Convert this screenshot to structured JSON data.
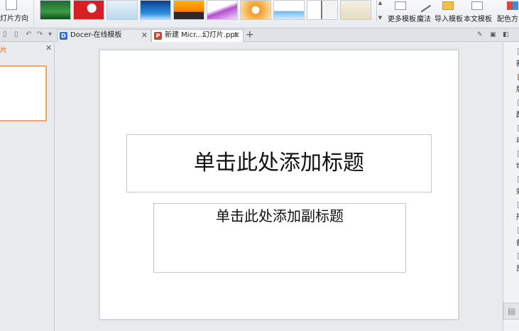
{
  "ribbon": {
    "direction_label": "灯片方向",
    "more_templates": "更多模板",
    "magic": "魔法",
    "import_template": "导入模板",
    "this_template": "本文模板",
    "color_scheme": "配色方"
  },
  "tabs": [
    {
      "label": "Docer-在线模板",
      "icon": "docer-icon"
    },
    {
      "label": "新建 Micr...幻灯片.ppt",
      "icon": "ppt-icon"
    }
  ],
  "left_pane": {
    "tab_label": "片"
  },
  "slide": {
    "title_placeholder": "单击此处添加标题",
    "subtitle_placeholder": "单击此处添加副标题"
  },
  "right_pane": {
    "items": [
      "新",
      "版",
      "配",
      "动",
      "切",
      "效",
      "形",
      "备",
      "反"
    ]
  },
  "colors": {
    "accent_orange": "#f2a55d",
    "ppt_icon": "#d0432c",
    "docer_icon": "#2f6fc8"
  }
}
